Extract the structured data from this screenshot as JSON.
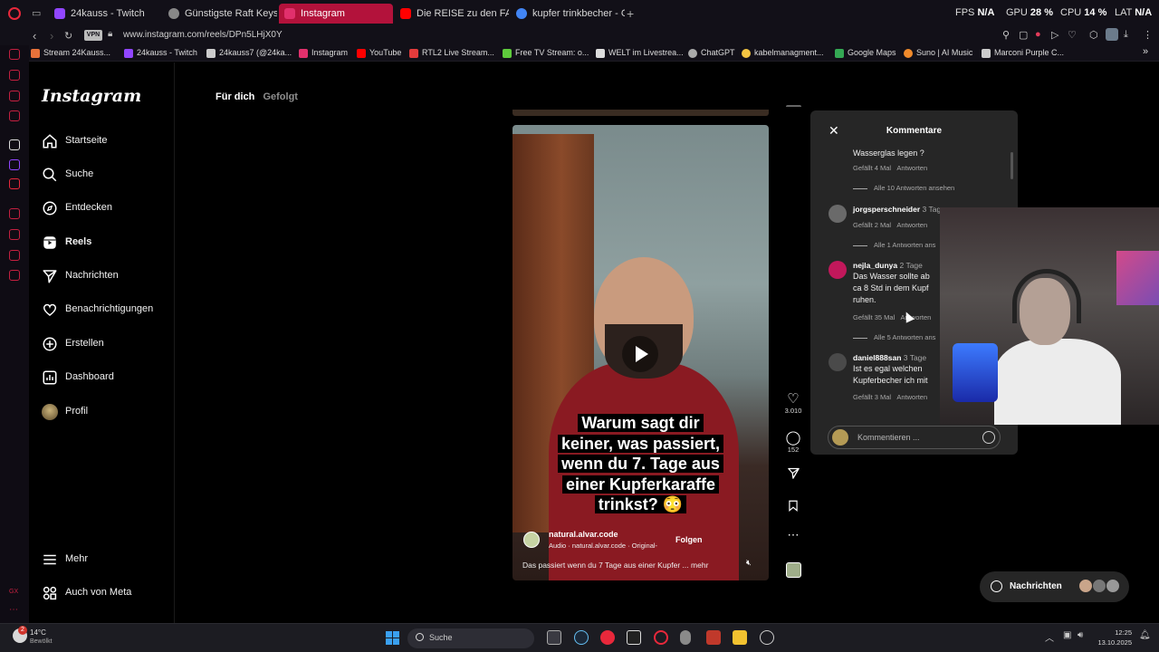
{
  "browser": {
    "tabs": [
      {
        "label": "24kauss - Twitch",
        "color": "#9146ff"
      },
      {
        "label": "Günstigste Raft Keys",
        "color": "#888888"
      },
      {
        "label": "Instagram",
        "color": "#e1306c"
      },
      {
        "label": "Die REISE zu den FAR LA",
        "color": "#ff0000"
      },
      {
        "label": "kupfer trinkbecher - Goog",
        "color": "#4285f4"
      }
    ],
    "perf": {
      "fps_label": "FPS",
      "fps_value": "N/A",
      "gpu_label": "GPU",
      "gpu_value": "28 %",
      "cpu_label": "CPU",
      "cpu_value": "14 %",
      "lat_label": "LAT",
      "lat_value": "N/A"
    },
    "vpn_badge": "VPN",
    "url": "www.instagram.com/reels/DPn5LHjX0Y",
    "bookmarks": [
      {
        "label": "Stream 24Kauss...",
        "color": "#e8723a"
      },
      {
        "label": "24kauss - Twitch",
        "color": "#9146ff"
      },
      {
        "label": "24kauss7 (@24ka...",
        "color": "#cccccc"
      },
      {
        "label": "Instagram",
        "color": "#e1306c"
      },
      {
        "label": "YouTube",
        "color": "#ff0000"
      },
      {
        "label": "RTL2 Live Stream...",
        "color": "#e23b3b"
      },
      {
        "label": "Free TV Stream: o...",
        "color": "#5ecb3c"
      },
      {
        "label": "WELT im Livestrea...",
        "color": "#dddddd"
      },
      {
        "label": "ChatGPT",
        "color": "#aaaaaa"
      },
      {
        "label": "kabelmanagment...",
        "color": "#f4c542"
      },
      {
        "label": "Google Maps",
        "color": "#34a853"
      },
      {
        "label": "Suno | AI Music",
        "color": "#f08a2b"
      },
      {
        "label": "Marconi Purple C...",
        "color": "#cccccc"
      }
    ]
  },
  "instagram": {
    "logo": "Instagram",
    "nav": [
      {
        "label": "Startseite",
        "icon": "home-icon"
      },
      {
        "label": "Suche",
        "icon": "search-icon"
      },
      {
        "label": "Entdecken",
        "icon": "compass-icon"
      },
      {
        "label": "Reels",
        "icon": "reels-icon"
      },
      {
        "label": "Nachrichten",
        "icon": "send-icon"
      },
      {
        "label": "Benachrichtigungen",
        "icon": "heart-icon"
      },
      {
        "label": "Erstellen",
        "icon": "plus-square-icon"
      },
      {
        "label": "Dashboard",
        "icon": "dashboard-icon"
      },
      {
        "label": "Profil",
        "icon": "avatar-icon"
      }
    ],
    "nav_bottom": [
      {
        "label": "Mehr",
        "icon": "menu-icon"
      },
      {
        "label": "Auch von Meta",
        "icon": "meta-grid-icon"
      }
    ],
    "feed_tabs": {
      "active": "Für dich",
      "inactive": "Gefolgt"
    },
    "reel": {
      "caption_lines": [
        "Warum sagt dir",
        "keiner, was passiert,",
        "wenn du 7. Tage aus",
        "einer Kupferkaraffe",
        "trinkst? 😳"
      ],
      "author": "natural.alvar.code",
      "audio": "Audio · natural.alvar.code · Original-",
      "follow_label": "Folgen",
      "description": "Das passiert wenn du 7 Tage aus einer Kupfer ...",
      "more_label": "mehr",
      "likes": "3.010",
      "comments_count": "152"
    },
    "comments_panel": {
      "title": "Kommentare",
      "items": [
        {
          "user": "",
          "time": "",
          "text": "Wasserglas legen ?",
          "likes": "Gefällt 4 Mal",
          "reply": "Antworten",
          "replies": "Alle 10 Antworten ansehen",
          "avatar_color": "#262626"
        },
        {
          "user": "jorgsperschneider",
          "time": "3 Tage",
          "text": "",
          "likes": "Gefällt 2 Mal",
          "reply": "Antworten",
          "replies": "Alle 1 Antworten ans",
          "avatar_color": "#6a6a6a"
        },
        {
          "user": "nejla_dunya",
          "time": "2 Tage",
          "text": "Das Wasser sollte ab ca 8 Std in dem Kupf ruhen.",
          "likes": "Gefällt 35 Mal",
          "reply": "Antworten",
          "replies": "Alle 5 Antworten ans",
          "avatar_color": "#c2185b"
        },
        {
          "user": "daniel888san",
          "time": "3 Tage",
          "text": "Ist es egal welchen Kupferbecher ich mit",
          "likes": "Gefällt 3 Mal",
          "reply": "Antworten",
          "replies": "",
          "avatar_color": "#4a4a4a"
        }
      ],
      "input_placeholder": "Kommentieren ..."
    },
    "messages_button": "Nachrichten"
  },
  "taskbar": {
    "weather_temp": "14°C",
    "weather_state": "Bewölkt",
    "notification_count": "2",
    "search_label": "Suche",
    "clock_time": "12:25",
    "clock_date": "13.10.2025"
  }
}
